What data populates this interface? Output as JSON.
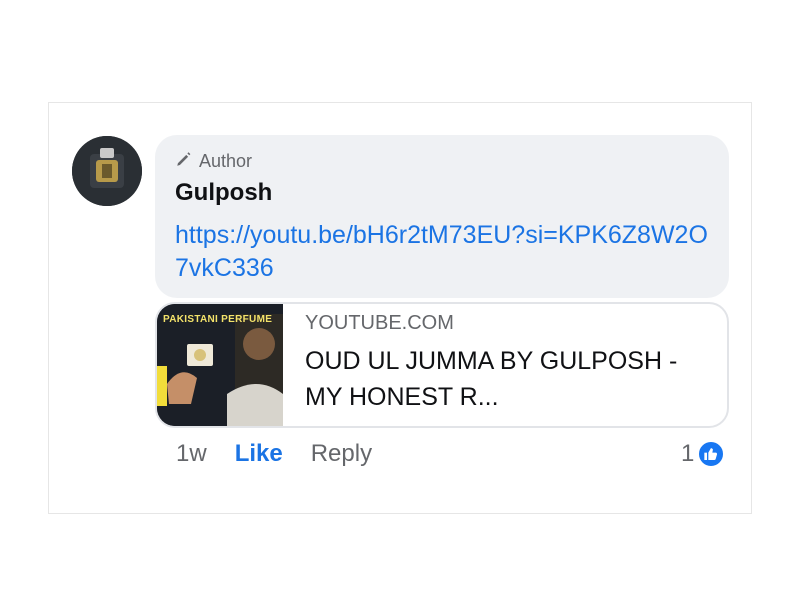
{
  "comment": {
    "role_badge": "Author",
    "author_name": "Gulposh",
    "link_text": "https://youtu.be/bH6r2tM73EU?si=KPK6Z8W2O7vkC336"
  },
  "preview": {
    "domain": "YOUTUBE.COM",
    "title": "OUD UL JUMMA BY GULPOSH - MY HONEST R...",
    "thumb_tag": "PAKISTANI PERFUME"
  },
  "actions": {
    "time": "1w",
    "like": "Like",
    "reply": "Reply",
    "reaction_count": "1"
  },
  "icons": {
    "role_icon": "pencil-icon",
    "reaction_icon": "thumbs-up-icon"
  },
  "colors": {
    "link": "#1b74e4",
    "bubble_bg": "#eff1f4",
    "reaction_bg": "#1877f2"
  }
}
